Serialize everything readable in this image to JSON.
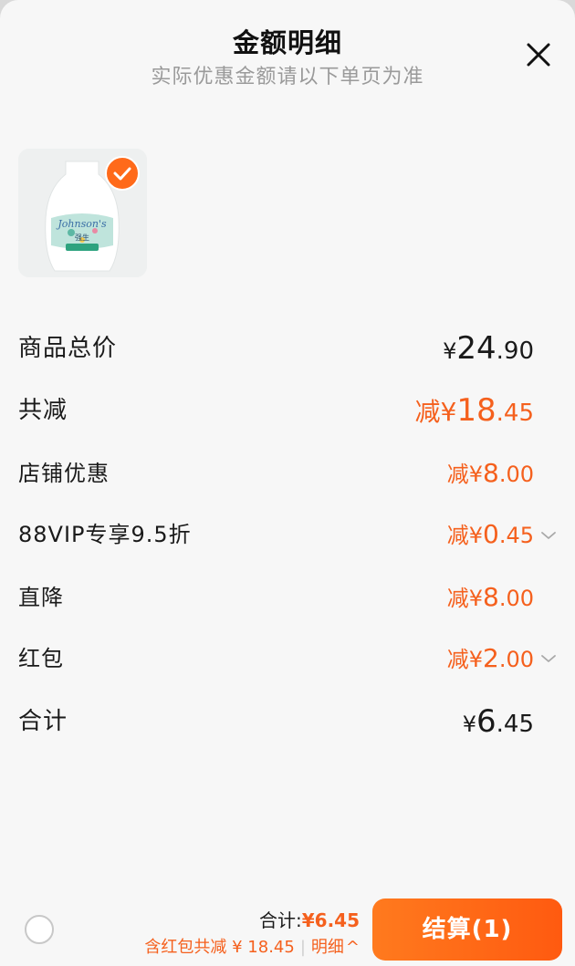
{
  "header": {
    "title": "金额明细",
    "subtitle": "实际优惠金额请以下单页为准"
  },
  "icons": {
    "close": "close-icon",
    "check": "check-icon",
    "chevron": "chevron-down-icon"
  },
  "product": {
    "selected": true,
    "brand_text": "Johnson's",
    "brand_text_cn": "强生"
  },
  "summary": {
    "subtotal_label": "商品总价",
    "subtotal_prefix": "¥",
    "subtotal_int": "24",
    "subtotal_dec": ".90",
    "total_discount_label": "共减",
    "total_discount_prefix": "减¥",
    "total_discount_int": "18",
    "total_discount_dec": ".45",
    "total_label": "合计",
    "total_prefix": "¥",
    "total_int": "6",
    "total_dec": ".45"
  },
  "discounts": [
    {
      "label": "店铺优惠",
      "prefix": "减¥",
      "int": "8",
      "dec": ".00",
      "expandable": false
    },
    {
      "label": "88VIP专享9.5折",
      "prefix": "减¥",
      "int": "0",
      "dec": ".45",
      "expandable": true
    },
    {
      "label": "直降",
      "prefix": "减¥",
      "int": "8",
      "dec": ".00",
      "expandable": false
    },
    {
      "label": "红包",
      "prefix": "减¥",
      "int": "2",
      "dec": ".00",
      "expandable": true
    }
  ],
  "bottom_bar": {
    "total_label": "合计:",
    "total_value": "¥6.45",
    "savings_text": "含红包共减 ¥ 18.45",
    "separator": "|",
    "detail_label": "明细",
    "detail_arrow": "^",
    "checkout_label": "结算(1)"
  },
  "colors": {
    "accent": "#f5601d",
    "button_start": "#ff7a1e",
    "button_end": "#ff5a10",
    "background": "#f7f7f7"
  }
}
